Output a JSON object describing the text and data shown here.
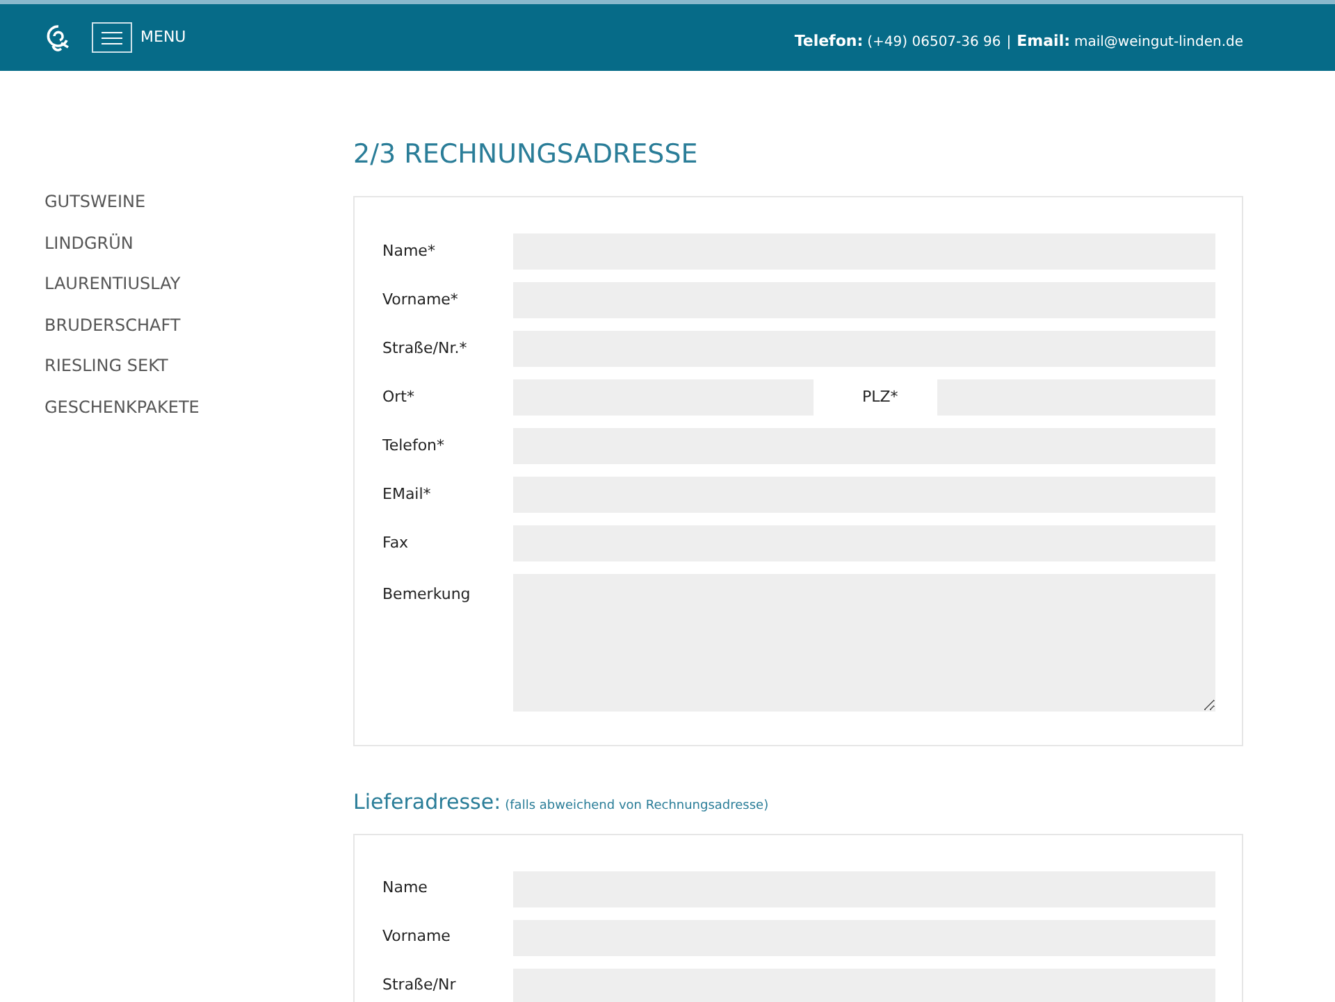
{
  "header": {
    "menu_label": "MENU",
    "contact_separator": "|",
    "contact": [
      {
        "label": "Telefon:",
        "value": "(+49) 06507-36 96"
      },
      {
        "label": "Email:",
        "value": "mail@weingut-linden.de"
      }
    ]
  },
  "sidebar": {
    "items": [
      "GUTSWEINE",
      "LINDGRÜN",
      "LAURENTIUSLAY",
      "BRUDERSCHAFT",
      "RIESLING SEKT",
      "GESCHENKPAKETE"
    ]
  },
  "title": "2/3 RECHNUNGSADRESSE",
  "billing_form": {
    "fields": [
      {
        "kind": "text",
        "label": "Name*"
      },
      {
        "kind": "text",
        "label": "Vorname*"
      },
      {
        "kind": "text",
        "label": "Straße/Nr.*"
      },
      {
        "kind": "split",
        "label": "Ort*",
        "second_label": "PLZ*"
      },
      {
        "kind": "text",
        "label": "Telefon*"
      },
      {
        "kind": "text",
        "label": "EMail*"
      },
      {
        "kind": "text",
        "label": "Fax"
      },
      {
        "kind": "textarea",
        "label": "Bemerkung"
      }
    ]
  },
  "delivery": {
    "heading": "Lieferadresse:",
    "note": "(falls abweichend von Rechnungsadresse)",
    "fields": [
      {
        "kind": "text",
        "label": "Name"
      },
      {
        "kind": "text",
        "label": "Vorname"
      },
      {
        "kind": "text",
        "label": "Straße/Nr"
      }
    ]
  }
}
